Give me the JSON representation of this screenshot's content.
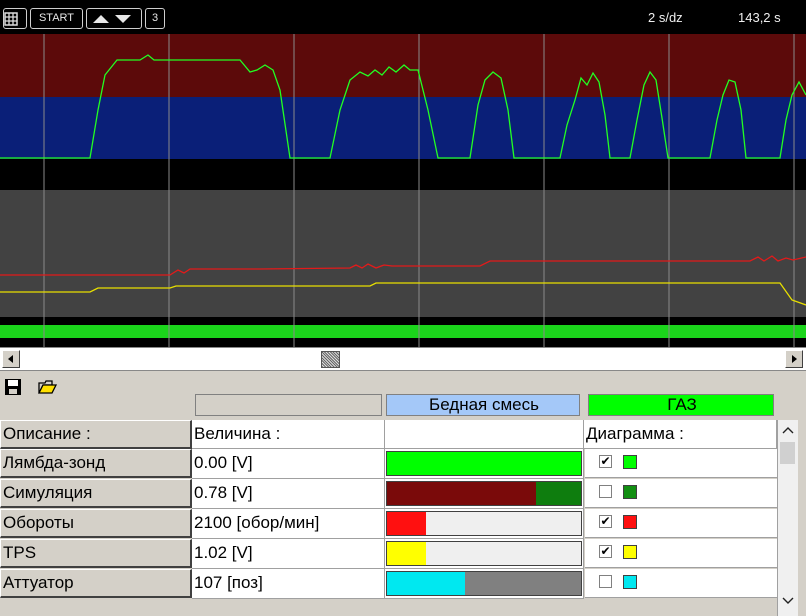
{
  "toolbar": {
    "grid_icon": "grid-icon",
    "start_label": "START",
    "up_icon": "triangle-up-icon",
    "down_icon": "triangle-down-icon",
    "channel_count": "3"
  },
  "scope": {
    "time_scale": "2 s/dz",
    "time_position": "143,2 s",
    "colors": {
      "band_top": "#5c0a0a",
      "band_mid": "#0a1f78",
      "band_gray": "#424242",
      "band_green": "#1bd51b",
      "trace_lambda": "#22ff22",
      "trace_rpm": "#e31a1a",
      "trace_tps": "#e8e000"
    }
  },
  "scrollbar": {
    "left_icon": "arrow-left-icon",
    "right_icon": "arrow-right-icon"
  },
  "panel": {
    "save_icon": "floppy-disk-icon",
    "open_icon": "folder-open-icon",
    "status_empty": "",
    "mixture_status": "Бедная смесь",
    "fuel_status": "ГАЗ",
    "mixture_color": "#a4c8f8",
    "fuel_color": "#00ff00",
    "headers": {
      "description": "Описание :",
      "value": "Величина :",
      "bar": "",
      "chart": "Диаграмма :"
    },
    "rows": [
      {
        "label": "Лямбда-зонд",
        "value": "0.00 [V]",
        "checked": true,
        "color": "#00ff00"
      },
      {
        "label": "Симуляция",
        "value": "0.78 [V]",
        "checked": false,
        "color": "#128f12"
      },
      {
        "label": "Обороты",
        "value": "2100 [обор/мин]",
        "checked": true,
        "color": "#ff1010"
      },
      {
        "label": "TPS",
        "value": "1.02 [V]",
        "checked": true,
        "color": "#ffff00"
      },
      {
        "label": "Аттуатор",
        "value": "107 [поз]",
        "checked": false,
        "color": "#00e8f0"
      }
    ],
    "bars": [
      {
        "fill": 1.0,
        "color": "#00ff00",
        "rest_color": "#00ff00"
      },
      {
        "fill": 0.77,
        "color": "#7a0a0a",
        "rest_color": "#0e7d0e"
      },
      {
        "fill": 0.2,
        "color": "#ff1010",
        "rest_color": "#efefef"
      },
      {
        "fill": 0.2,
        "color": "#ffff00",
        "rest_color": "#efefef"
      },
      {
        "fill": 0.4,
        "color": "#00e8f0",
        "rest_color": "#808080"
      }
    ]
  }
}
